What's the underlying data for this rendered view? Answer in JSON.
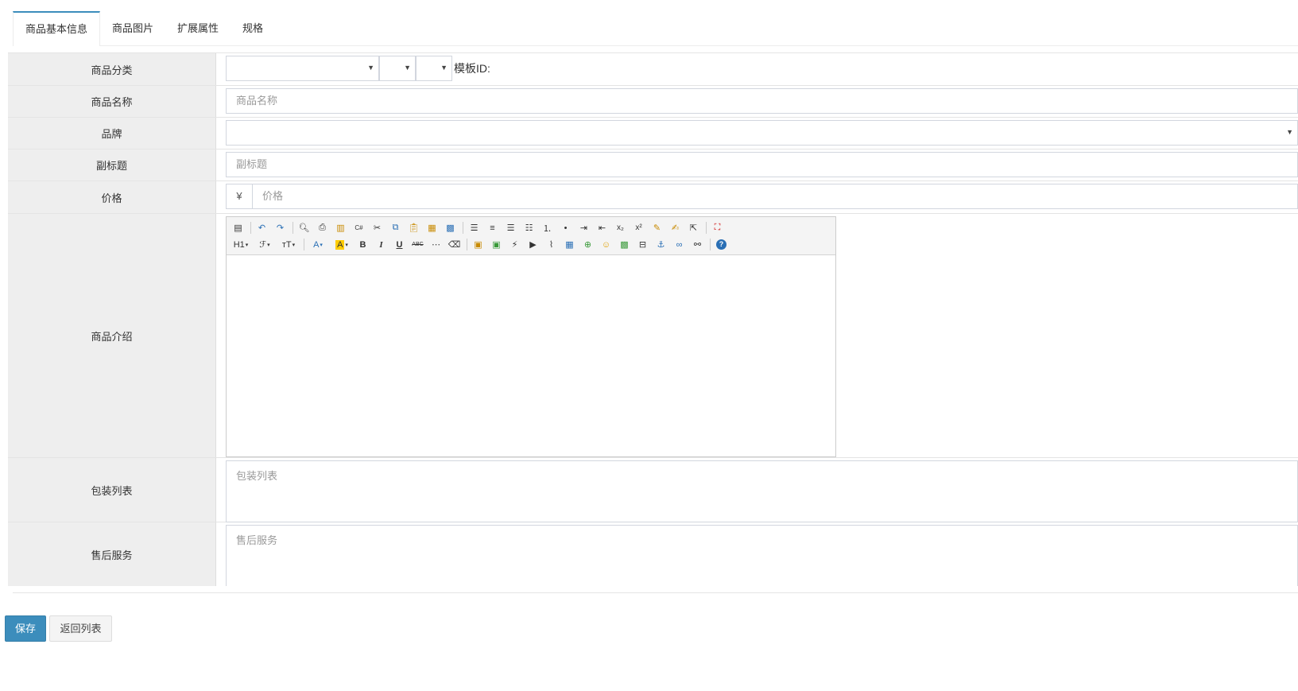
{
  "tabs": [
    {
      "label": "商品基本信息",
      "active": true
    },
    {
      "label": "商品图片"
    },
    {
      "label": "扩展属性"
    },
    {
      "label": "规格"
    }
  ],
  "form": {
    "category": {
      "label": "商品分类",
      "template_label": "模板ID:"
    },
    "name": {
      "label": "商品名称",
      "placeholder": "商品名称"
    },
    "brand": {
      "label": "品牌"
    },
    "subtitle": {
      "label": "副标题",
      "placeholder": "副标题"
    },
    "price": {
      "label": "价格",
      "currency": "¥",
      "placeholder": "价格"
    },
    "intro": {
      "label": "商品介绍"
    },
    "package": {
      "label": "包装列表",
      "placeholder": "包装列表"
    },
    "service": {
      "label": "售后服务",
      "placeholder": "售后服务"
    }
  },
  "editor": {
    "toolbar_text": {
      "heading": "H1",
      "font_family": "ℱ",
      "font_size": "тT",
      "font_color": "A",
      "bg_color": "A",
      "bold": "B",
      "italic": "I",
      "underline": "U",
      "strike": "ABC"
    }
  },
  "buttons": {
    "save": "保存",
    "back": "返回列表"
  },
  "colors": {
    "primary": "#3c8dbc",
    "label_bg": "#eeeeee",
    "border": "#d2d6de"
  }
}
